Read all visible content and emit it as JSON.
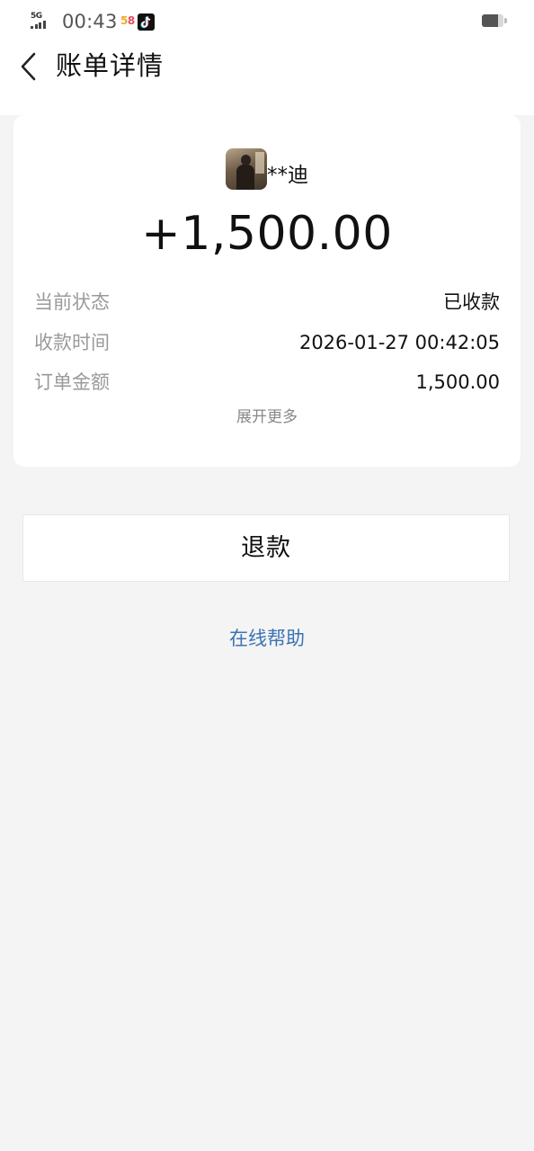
{
  "status_bar": {
    "network": "5G",
    "time": "00:43",
    "app_icons": [
      "app-58-icon",
      "tiktok-icon"
    ],
    "app58_label": "58",
    "battery_level": 0.75
  },
  "nav": {
    "title": "账单详情"
  },
  "bill": {
    "payer_name": "**迪",
    "amount": "+1,500.00",
    "details": [
      {
        "label": "当前状态",
        "value": "已收款"
      },
      {
        "label": "收款时间",
        "value": "2026-01-27 00:42:05"
      },
      {
        "label": "订单金额",
        "value": "1,500.00"
      }
    ],
    "expand_label": "展开更多"
  },
  "actions": {
    "refund_label": "退款"
  },
  "help": {
    "label": "在线帮助",
    "color": "#3a73b5"
  }
}
